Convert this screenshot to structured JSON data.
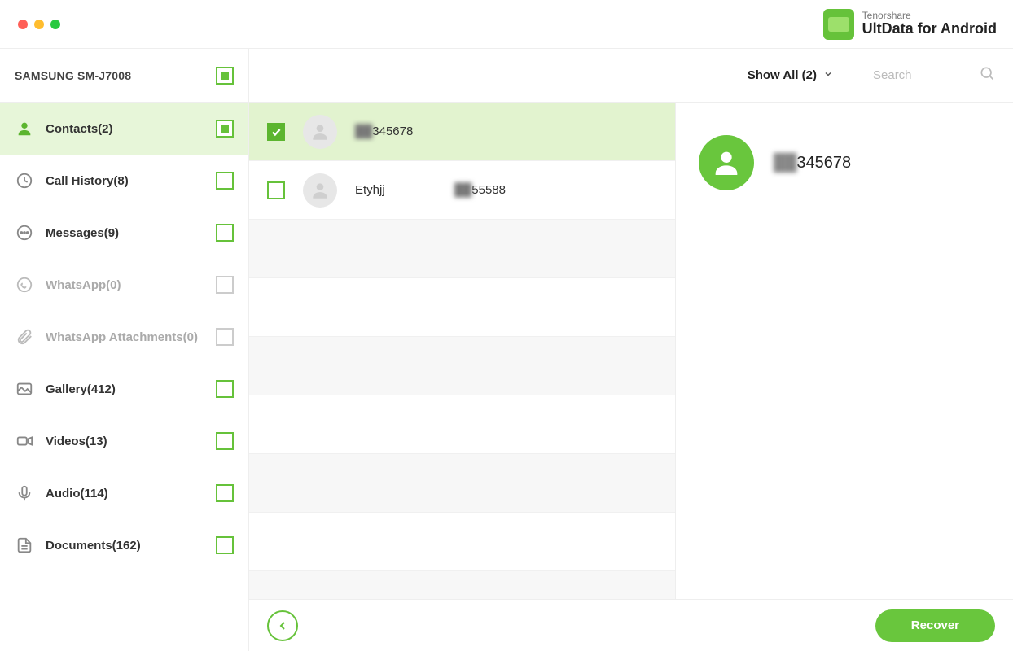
{
  "brand": {
    "company": "Tenorshare",
    "product": "UltData for Android"
  },
  "device": {
    "name": "SAMSUNG SM-J7008",
    "check_state": "indeterminate"
  },
  "toolbar": {
    "show_all_label": "Show All (2)",
    "search_placeholder": "Search"
  },
  "sidebar": [
    {
      "id": "contacts",
      "label": "Contacts(2)",
      "icon": "contacts",
      "check": "indeterminate",
      "active": true,
      "dim": false
    },
    {
      "id": "callhist",
      "label": "Call History(8)",
      "icon": "clock",
      "check": "empty",
      "active": false,
      "dim": false
    },
    {
      "id": "messages",
      "label": "Messages(9)",
      "icon": "chat",
      "check": "empty",
      "active": false,
      "dim": false
    },
    {
      "id": "whatsapp",
      "label": "WhatsApp(0)",
      "icon": "whatsapp",
      "check": "dim",
      "active": false,
      "dim": true
    },
    {
      "id": "whatsatt",
      "label": "WhatsApp Attachments(0)",
      "icon": "attachment",
      "check": "dim",
      "active": false,
      "dim": true
    },
    {
      "id": "gallery",
      "label": "Gallery(412)",
      "icon": "image",
      "check": "empty",
      "active": false,
      "dim": false
    },
    {
      "id": "videos",
      "label": "Videos(13)",
      "icon": "video",
      "check": "empty",
      "active": false,
      "dim": false
    },
    {
      "id": "audio",
      "label": "Audio(114)",
      "icon": "mic",
      "check": "empty",
      "active": false,
      "dim": false
    },
    {
      "id": "documents",
      "label": "Documents(162)",
      "icon": "document",
      "check": "empty",
      "active": false,
      "dim": false
    }
  ],
  "contacts": [
    {
      "selected": true,
      "name_prefix_hidden": "██",
      "name_suffix": "345678",
      "number_hidden": "",
      "number_suffix": ""
    },
    {
      "selected": false,
      "name_prefix_hidden": "",
      "name_suffix": "Etyhjj",
      "number_hidden": "██",
      "number_suffix": "55588"
    }
  ],
  "detail": {
    "name_prefix_hidden": "██",
    "name_suffix": "345678"
  },
  "footer": {
    "recover_label": "Recover"
  }
}
